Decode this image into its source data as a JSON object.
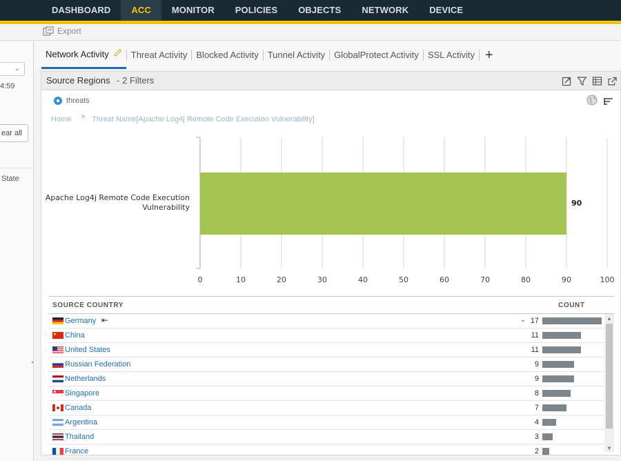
{
  "nav": {
    "items": [
      "DASHBOARD",
      "ACC",
      "MONITOR",
      "POLICIES",
      "OBJECTS",
      "NETWORK",
      "DEVICE"
    ],
    "active": "ACC"
  },
  "toolbar": {
    "export_label": "Export"
  },
  "sidebar": {
    "time_fragment": "4:59",
    "clear_fragment": "ear all",
    "state_fragment": "State"
  },
  "tabs": {
    "items": [
      "Network Activity",
      "Threat Activity",
      "Blocked Activity",
      "Tunnel Activity",
      "GlobalProtect Activity",
      "SSL Activity"
    ],
    "active": "Network Activity",
    "add_icon": "plus-icon"
  },
  "widget": {
    "title": "Source Regions",
    "filters": "- 2 Filters",
    "legend_label": "threats",
    "breadcrumb": {
      "home": "Home",
      "filter": "Threat Name[Apache Log4j Remote Code Execution Vulnerability]"
    }
  },
  "chart_data": {
    "type": "bar",
    "orientation": "horizontal",
    "categories": [
      "Apache Log4j Remote Code Execution Vulnerability"
    ],
    "category_lines": [
      "Apache Log4j Remote Code Execution",
      "Vulnerability"
    ],
    "values": [
      90
    ],
    "xlim": [
      0,
      100
    ],
    "xticks": [
      0,
      10,
      20,
      30,
      40,
      50,
      60,
      70,
      80,
      90,
      100
    ],
    "bar_color": "#a3c451",
    "grid": true,
    "data_labels": true
  },
  "table": {
    "headers": {
      "country": "SOURCE COUNTRY",
      "count": "COUNT"
    },
    "rows": [
      {
        "country": "Germany",
        "count": 17,
        "flag": "de"
      },
      {
        "country": "China",
        "count": 11,
        "flag": "cn"
      },
      {
        "country": "United States",
        "count": 11,
        "flag": "us"
      },
      {
        "country": "Russian Federation",
        "count": 9,
        "flag": "ru"
      },
      {
        "country": "Netherlands",
        "count": 9,
        "flag": "nl"
      },
      {
        "country": "Singapore",
        "count": 8,
        "flag": "sg"
      },
      {
        "country": "Canada",
        "count": 7,
        "flag": "ca"
      },
      {
        "country": "Argentina",
        "count": 4,
        "flag": "ar"
      },
      {
        "country": "Thailand",
        "count": 3,
        "flag": "th"
      },
      {
        "country": "France",
        "count": 2,
        "flag": "fr"
      }
    ],
    "max_count": 17
  },
  "colors": {
    "nav_bg": "#182a33",
    "accent": "#f5c400",
    "link": "#1f6db5",
    "bar": "#a3c451",
    "count_bar": "#7d868c"
  }
}
